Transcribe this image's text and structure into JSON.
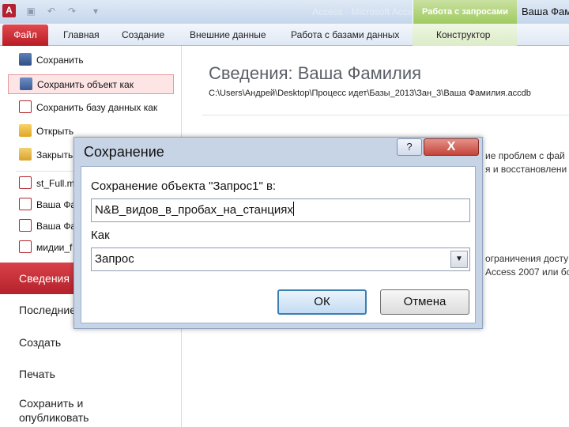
{
  "titlebar": {
    "app_icon": "A",
    "title": "Access - Microsoft Access",
    "context_tab": "Работа с запросами",
    "account": "Ваша Фами",
    "icons": [
      "save-icon",
      "undo-icon",
      "redo-icon",
      "dropdown-icon"
    ]
  },
  "ribbon": {
    "file_tab": "Файл",
    "tabs": [
      "Главная",
      "Создание",
      "Внешние данные",
      "Работа с базами данных",
      "Конструктор"
    ]
  },
  "backstage": {
    "menu": [
      {
        "label": "Сохранить",
        "icon": "save-icon"
      },
      {
        "label": "Сохранить объект как",
        "icon": "save-object-icon"
      },
      {
        "label": "Сохранить базу данных как",
        "icon": "save-database-icon"
      },
      {
        "label": "Открыть",
        "icon": "open-folder-icon"
      },
      {
        "label": "Закрыть",
        "icon": "close-database-icon"
      }
    ],
    "recent": [
      "st_Full.m",
      "Ваша Фа",
      "Ваша Фа",
      "мидии_f"
    ],
    "nav": [
      "Сведения",
      "Последние",
      "Создать",
      "Печать",
      "Сохранить и\nопубликовать"
    ],
    "heading": "Сведения: Ваша Фамилия",
    "path": "C:\\Users\\Андрей\\Desktop\\Процесс идет\\Базы_2013\\Зан_3\\Ваша Фамилия.accdb",
    "fragments": [
      "ие проблем с фай",
      "я и восстановлени",
      "ограничения досту",
      "Access 2007 или бо"
    ]
  },
  "dialog": {
    "title": "Сохранение",
    "help_label": "?",
    "close_label": "X",
    "prompt": "Сохранение объекта \"Запрос1\" в:",
    "name_value": "N&B_видов_в_пробах_на_станциях",
    "as_label": "Как",
    "as_value": "Запрос",
    "ok_label": "ОК",
    "cancel_label": "Отмена"
  }
}
